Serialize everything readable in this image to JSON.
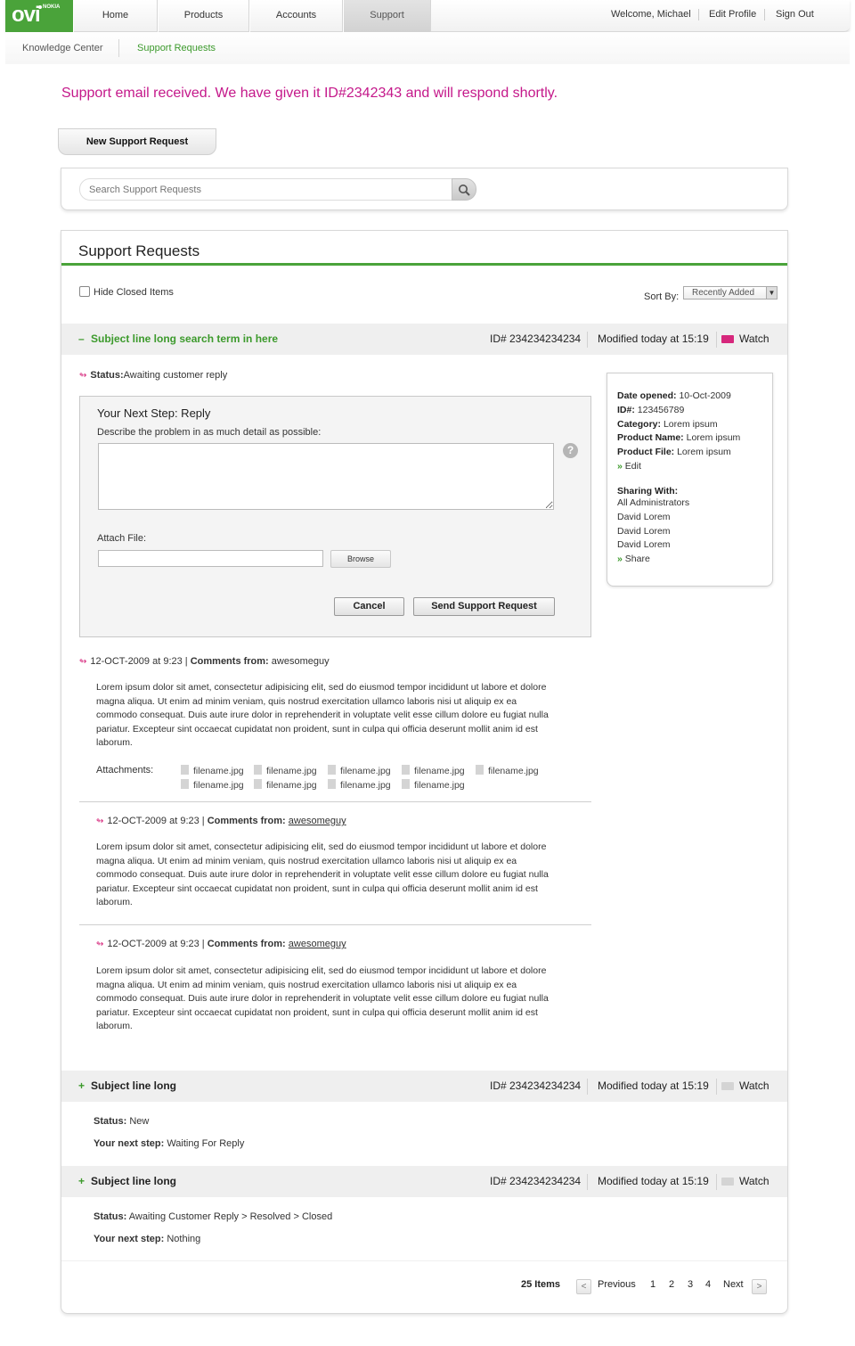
{
  "nav": {
    "logo_text": "ovi",
    "logo_brand": "NOKIA",
    "tabs": [
      "Home",
      "Products",
      "Accounts",
      "Support"
    ],
    "active_tab": "Support",
    "welcome": "Welcome, Michael",
    "edit_profile": "Edit Profile",
    "sign_out": "Sign Out"
  },
  "subnav": {
    "items": [
      "Knowledge Center",
      "Support Requests"
    ],
    "active": "Support Requests"
  },
  "notice": "Support email received. We have given it ID#2342343 and will respond shortly.",
  "new_request_button": "New Support Request",
  "search": {
    "placeholder": "Search Support Requests"
  },
  "panel": {
    "title": "Support Requests",
    "hide_closed_label": "Hide Closed Items",
    "sort_label": "Sort By:",
    "sort_value": "Recently Added"
  },
  "requests": [
    {
      "toggle": "–",
      "subject": "Subject line long search term in here",
      "id": "ID# 234234234234",
      "modified": "Modified today at 15:19",
      "watch": "Watch",
      "status_label": "Status:",
      "status_value": "Awaiting customer reply",
      "reply": {
        "title": "Your Next Step: Reply",
        "description": "Describe the problem in as much detail as possible:",
        "help_icon": "?",
        "attach_label": "Attach File:",
        "browse": "Browse",
        "cancel": "Cancel",
        "send": "Send Support Request"
      },
      "details": {
        "date_opened_label": "Date opened:",
        "date_opened": "10-Oct-2009",
        "id_label": "ID#:",
        "id": "123456789",
        "category_label": "Category:",
        "category": "Lorem ipsum",
        "product_name_label": "Product Name:",
        "product_name": "Lorem ipsum",
        "product_file_label": "Product File:",
        "product_file": "Lorem ipsum",
        "edit": "Edit",
        "sharing_label": "Sharing With:",
        "sharing": [
          "All Administrators",
          "David Lorem",
          "David Lorem",
          "David Lorem"
        ],
        "share": "Share"
      },
      "comments": [
        {
          "date": "12-OCT-2009 at 9:23",
          "from_label": "Comments from:",
          "user": "awesomeguy",
          "body": "Lorem ipsum dolor sit amet, consectetur adipisicing elit, sed do eiusmod tempor incididunt ut labore et dolore magna aliqua. Ut enim ad minim veniam, quis nostrud exercitation ullamco laboris nisi ut aliquip ex ea commodo consequat. Duis aute irure dolor in reprehenderit in voluptate velit esse cillum dolore eu fugiat nulla pariatur. Excepteur sint occaecat cupidatat non proident, sunt in culpa qui officia deserunt mollit anim id est laborum.",
          "attachments_label": "Attachments:",
          "attachments": [
            "filename.jpg",
            "filename.jpg",
            "filename.jpg",
            "filename.jpg",
            "filename.jpg",
            "filename.jpg",
            "filename.jpg",
            "filename.jpg",
            "filename.jpg"
          ]
        },
        {
          "date": "12-OCT-2009 at 9:23",
          "from_label": "Comments from:",
          "user": "awesomeguy",
          "body": "Lorem ipsum dolor sit amet, consectetur adipisicing elit, sed do eiusmod tempor incididunt ut labore et dolore magna aliqua. Ut enim ad minim veniam, quis nostrud exercitation ullamco laboris nisi ut aliquip ex ea commodo consequat. Duis aute irure dolor in reprehenderit in voluptate velit esse cillum dolore eu fugiat nulla pariatur. Excepteur sint occaecat cupidatat non proident, sunt in culpa qui officia deserunt mollit anim id est laborum."
        },
        {
          "date": "12-OCT-2009 at 9:23",
          "from_label": "Comments from:",
          "user": "awesomeguy",
          "body": "Lorem ipsum dolor sit amet, consectetur adipisicing elit, sed do eiusmod tempor incididunt ut labore et dolore magna aliqua. Ut enim ad minim veniam, quis nostrud exercitation ullamco laboris nisi ut aliquip ex ea commodo consequat. Duis aute irure dolor in reprehenderit in voluptate velit esse cillum dolore eu fugiat nulla pariatur. Excepteur sint occaecat cupidatat non proident, sunt in culpa qui officia deserunt mollit anim id est laborum."
        }
      ]
    },
    {
      "toggle": "+",
      "subject": "Subject line long",
      "id": "ID# 234234234234",
      "modified": "Modified today at 15:19",
      "watch": "Watch",
      "status_label": "Status:",
      "status_value": "New",
      "next_step_label": "Your next step:",
      "next_step_value": "Waiting For Reply"
    },
    {
      "toggle": "+",
      "subject": "Subject line long",
      "id": "ID# 234234234234",
      "modified": "Modified today at 15:19",
      "watch": "Watch",
      "status_label": "Status:",
      "status_value": "Awaiting Customer Reply > Resolved > Closed",
      "next_step_label": "Your next step:",
      "next_step_value": "Nothing"
    }
  ],
  "pagination": {
    "count": "25 Items",
    "prev_icon": "<",
    "previous": "Previous",
    "pages": [
      "1",
      "2",
      "3",
      "4"
    ],
    "next": "Next",
    "next_icon": ">"
  },
  "icons": {
    "arrow": "↬",
    "search": "search-icon",
    "mail": "mail-icon",
    "file": "file-icon"
  },
  "colors": {
    "brand_green": "#4aa33a",
    "accent_pink": "#c4188a",
    "watch_active": "#d6277c"
  }
}
